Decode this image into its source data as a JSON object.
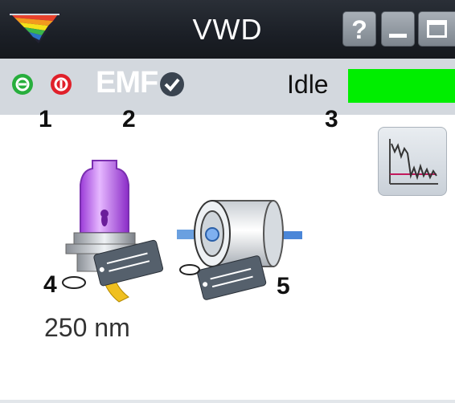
{
  "window": {
    "title": "VWD",
    "help_label": "?"
  },
  "status": {
    "emf_label": "EMF",
    "state_text": "Idle",
    "state_color": "#00ee00"
  },
  "callouts": [
    "1",
    "2",
    "3",
    "4",
    "5"
  ],
  "lamp": {
    "wavelength": "250 nm"
  },
  "colors": {
    "titlebar": "#1b1f26",
    "statusbar": "#d3d8de",
    "on_button": "#27ae3c",
    "off_button": "#e0202a"
  },
  "icons": {
    "logo": "rainbow-prism-icon",
    "help": "help-icon",
    "minimize": "minimize-icon",
    "maximize": "maximize-icon",
    "on": "on-icon",
    "off": "off-icon",
    "emf_ok": "check-icon",
    "chart": "signal-plot-icon",
    "lamp": "lamp-icon",
    "cell": "flow-cell-icon"
  }
}
